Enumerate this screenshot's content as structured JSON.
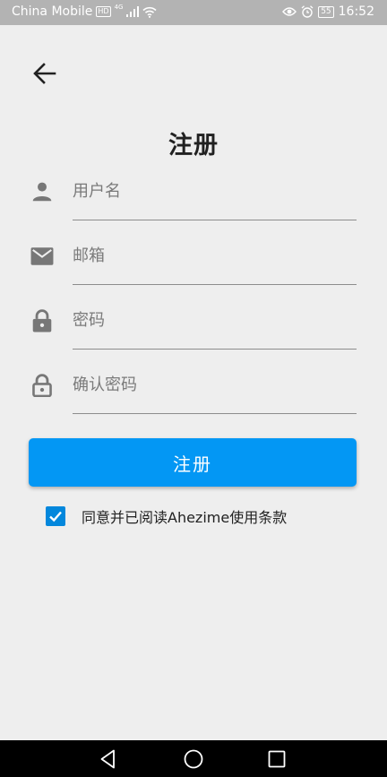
{
  "status_bar": {
    "carrier": "China Mobile",
    "hd_badge": "HD",
    "network": "4G",
    "battery": "55",
    "time": "16:52"
  },
  "page": {
    "title": "注册"
  },
  "form": {
    "username_placeholder": "用户名",
    "email_placeholder": "邮箱",
    "password_placeholder": "密码",
    "confirm_placeholder": "确认密码",
    "submit_label": "注册",
    "agree_checked": true,
    "agree_text": "同意并已阅读Ahezime使用条款"
  },
  "colors": {
    "accent": "#0397f4",
    "checkbox": "#0387dc",
    "background": "#eeeeee",
    "icon": "#777777"
  },
  "icons": {
    "back": "arrow-left-icon",
    "username": "person-icon",
    "email": "mail-icon",
    "password": "lock-icon",
    "confirm": "lock-open-icon",
    "nav": [
      "back-triangle-icon",
      "home-circle-icon",
      "recents-square-icon"
    ]
  }
}
